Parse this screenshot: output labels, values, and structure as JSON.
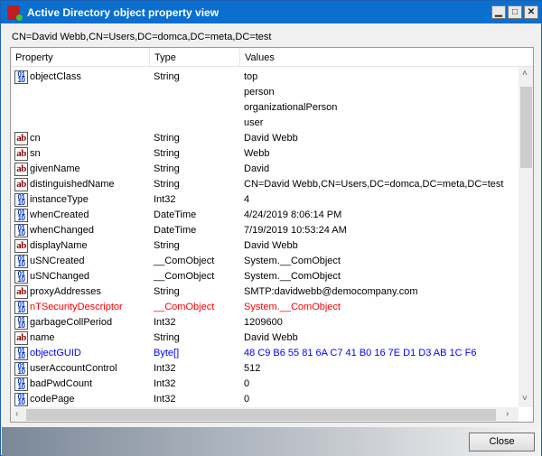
{
  "window": {
    "title": "Active Directory object property view"
  },
  "path": "CN=David Webb,CN=Users,DC=domca,DC=meta,DC=test",
  "columns": [
    "Property",
    "Type",
    "Values"
  ],
  "colors": {
    "title_bar": "#0b6fcf",
    "error": "#ff0000",
    "highlight": "#0000ff"
  },
  "rows": [
    {
      "icon": "bin",
      "name": "objectClass",
      "type": "String",
      "values": [
        "top",
        "person",
        "organizationalPerson",
        "user"
      ]
    },
    {
      "icon": "ab",
      "name": "cn",
      "type": "String",
      "values": [
        "David Webb"
      ]
    },
    {
      "icon": "ab",
      "name": "sn",
      "type": "String",
      "values": [
        "Webb"
      ]
    },
    {
      "icon": "ab",
      "name": "givenName",
      "type": "String",
      "values": [
        "David"
      ]
    },
    {
      "icon": "ab",
      "name": "distinguishedName",
      "type": "String",
      "values": [
        "CN=David Webb,CN=Users,DC=domca,DC=meta,DC=test"
      ]
    },
    {
      "icon": "bin",
      "name": "instanceType",
      "type": "Int32",
      "values": [
        "4"
      ]
    },
    {
      "icon": "bin",
      "name": "whenCreated",
      "type": "DateTime",
      "values": [
        "4/24/2019 8:06:14 PM"
      ]
    },
    {
      "icon": "bin",
      "name": "whenChanged",
      "type": "DateTime",
      "values": [
        "7/19/2019 10:53:24 AM"
      ]
    },
    {
      "icon": "ab",
      "name": "displayName",
      "type": "String",
      "values": [
        "David Webb"
      ]
    },
    {
      "icon": "bin",
      "name": "uSNCreated",
      "type": "__ComObject",
      "values": [
        "System.__ComObject"
      ]
    },
    {
      "icon": "bin",
      "name": "uSNChanged",
      "type": "__ComObject",
      "values": [
        "System.__ComObject"
      ]
    },
    {
      "icon": "ab",
      "name": "proxyAddresses",
      "type": "String",
      "values": [
        "SMTP:davidwebb@democompany.com"
      ]
    },
    {
      "icon": "bin",
      "name": "nTSecurityDescriptor",
      "type": "__ComObject",
      "values": [
        "System.__ComObject"
      ],
      "color": "#ff0000"
    },
    {
      "icon": "bin",
      "name": "garbageCollPeriod",
      "type": "Int32",
      "values": [
        "1209600"
      ]
    },
    {
      "icon": "ab",
      "name": "name",
      "type": "String",
      "values": [
        "David Webb"
      ]
    },
    {
      "icon": "bin",
      "name": "objectGUID",
      "type": "Byte[]",
      "values": [
        "48 C9 B6 55 81 6A C7 41 B0 16 7E D1 D3 AB 1C F6"
      ],
      "color": "#0000ff"
    },
    {
      "icon": "bin",
      "name": "userAccountControl",
      "type": "Int32",
      "values": [
        "512"
      ]
    },
    {
      "icon": "bin",
      "name": "badPwdCount",
      "type": "Int32",
      "values": [
        "0"
      ]
    },
    {
      "icon": "bin",
      "name": "codePage",
      "type": "Int32",
      "values": [
        "0"
      ]
    }
  ],
  "buttons": {
    "close": "Close"
  }
}
